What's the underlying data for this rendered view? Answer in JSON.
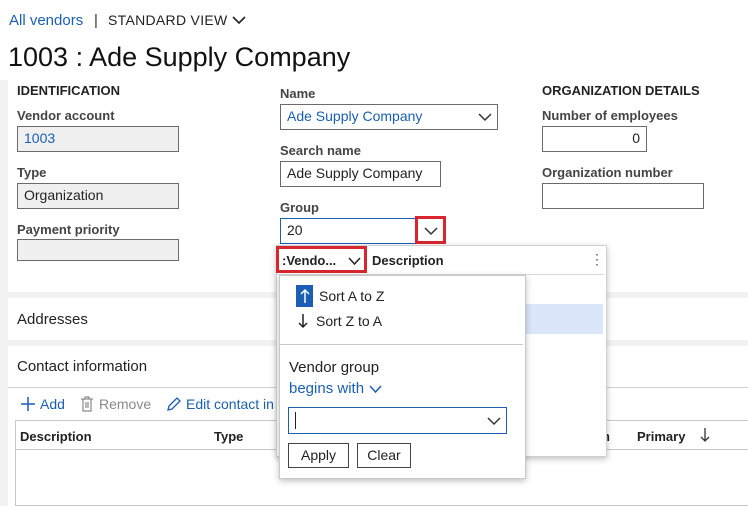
{
  "breadcrumb": {
    "link": "All vendors",
    "separator": "|",
    "view": "STANDARD VIEW"
  },
  "page": {
    "title": "1003 : Ade Supply Company"
  },
  "identification": {
    "heading": "IDENTIFICATION",
    "vendor_account_label": "Vendor account",
    "vendor_account_value": "1003",
    "type_label": "Type",
    "type_value": "Organization",
    "payment_priority_label": "Payment priority",
    "payment_priority_value": ""
  },
  "general": {
    "name_label": "Name",
    "name_value": "Ade Supply Company",
    "search_name_label": "Search name",
    "search_name_value": "Ade Supply Company",
    "group_label": "Group",
    "group_value": "20"
  },
  "organization": {
    "heading": "ORGANIZATION DETAILS",
    "employees_label": "Number of employees",
    "employees_value": "0",
    "org_number_label": "Organization number",
    "org_number_value": ""
  },
  "lookup": {
    "column1": ":Vendo...",
    "column2": "Description",
    "more": "⋮",
    "sort_az": "Sort A to Z",
    "sort_za": "Sort Z to A",
    "filter_label": "Vendor group",
    "operator": "begins with",
    "filter_value": "",
    "apply": "Apply",
    "clear": "Clear"
  },
  "sections": {
    "addresses": "Addresses",
    "contact": "Contact information"
  },
  "contact_toolbar": {
    "add": "Add",
    "remove": "Remove",
    "edit": "Edit contact in"
  },
  "contact_grid": {
    "col_description": "Description",
    "col_type": "Type",
    "col_partial": "n",
    "col_primary": "Primary"
  },
  "colors": {
    "accent": "#1a5fb4",
    "highlight": "#d9262e",
    "selected_row": "#dce6fa"
  }
}
